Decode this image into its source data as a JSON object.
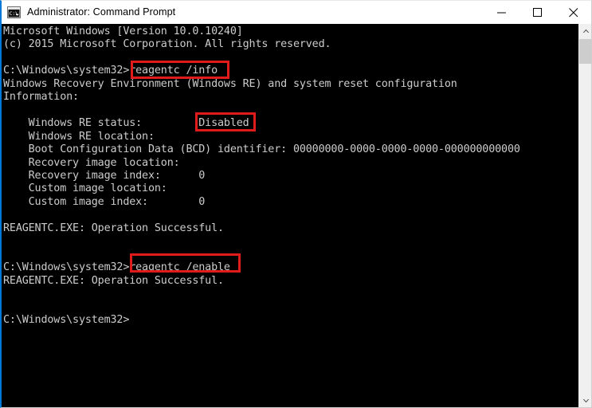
{
  "window": {
    "title": "Administrator: Command Prompt",
    "icon": "command-prompt-icon",
    "accent_color": "#0078d7",
    "background_color": "#000000",
    "text_color": "#cccccc",
    "annotation_color": "#e01b1b"
  },
  "titlebar_buttons": {
    "minimize": "minimize",
    "maximize": "maximize",
    "close": "close"
  },
  "console": {
    "lines": [
      "Microsoft Windows [Version 10.0.10240]",
      "(c) 2015 Microsoft Corporation. All rights reserved.",
      "",
      "C:\\Windows\\system32>reagentc /info",
      "Windows Recovery Environment (Windows RE) and system reset configuration",
      "Information:",
      "",
      "    Windows RE status:         Disabled",
      "    Windows RE location:",
      "    Boot Configuration Data (BCD) identifier: 00000000-0000-0000-0000-000000000000",
      "    Recovery image location:",
      "    Recovery image index:      0",
      "    Custom image location:",
      "    Custom image index:        0",
      "",
      "REAGENTC.EXE: Operation Successful.",
      "",
      "",
      "C:\\Windows\\system32>reagentc /enable",
      "REAGENTC.EXE: Operation Successful.",
      "",
      "",
      "C:\\Windows\\system32>"
    ],
    "full_text": "Microsoft Windows [Version 10.0.10240]\n(c) 2015 Microsoft Corporation. All rights reserved.\n\nC:\\Windows\\system32>reagentc /info\nWindows Recovery Environment (Windows RE) and system reset configuration\nInformation:\n\n    Windows RE status:         Disabled\n    Windows RE location:\n    Boot Configuration Data (BCD) identifier: 00000000-0000-0000-0000-000000000000\n    Recovery image location:\n    Recovery image index:      0\n    Custom image location:\n    Custom image index:        0\n\nREAGENTC.EXE: Operation Successful.\n\n\nC:\\Windows\\system32>reagentc /enable\nREAGENTC.EXE: Operation Successful.\n\n\nC:\\Windows\\system32>"
  },
  "annotations": [
    {
      "name": "highlight-reagentc-info",
      "text": "reagentc /info"
    },
    {
      "name": "highlight-disabled-status",
      "text": "Disabled"
    },
    {
      "name": "highlight-reagentc-enable",
      "text": "reagentc /enable"
    }
  ],
  "scrollbar": {
    "up_arrow": "▲",
    "down_arrow": "▼"
  }
}
